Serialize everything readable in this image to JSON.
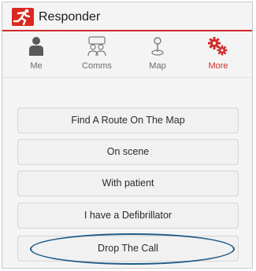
{
  "app": {
    "title": "Responder",
    "logo": "runner-logo-icon",
    "accent": "#d12b2b"
  },
  "tabs": [
    {
      "label": "Me",
      "icon": "person-icon",
      "active": false
    },
    {
      "label": "Comms",
      "icon": "people-icon",
      "active": false
    },
    {
      "label": "Map",
      "icon": "map-pin-icon",
      "active": false
    },
    {
      "label": "More",
      "icon": "gears-icon",
      "active": true
    }
  ],
  "actions": [
    {
      "label": "Find A Route On The Map"
    },
    {
      "label": "On scene"
    },
    {
      "label": "With patient"
    },
    {
      "label": "I have a Defibrillator"
    },
    {
      "label": "Drop The Call"
    }
  ],
  "annotation": {
    "shape": "ellipse",
    "color": "#1f5b86",
    "target": "Drop The Call"
  }
}
